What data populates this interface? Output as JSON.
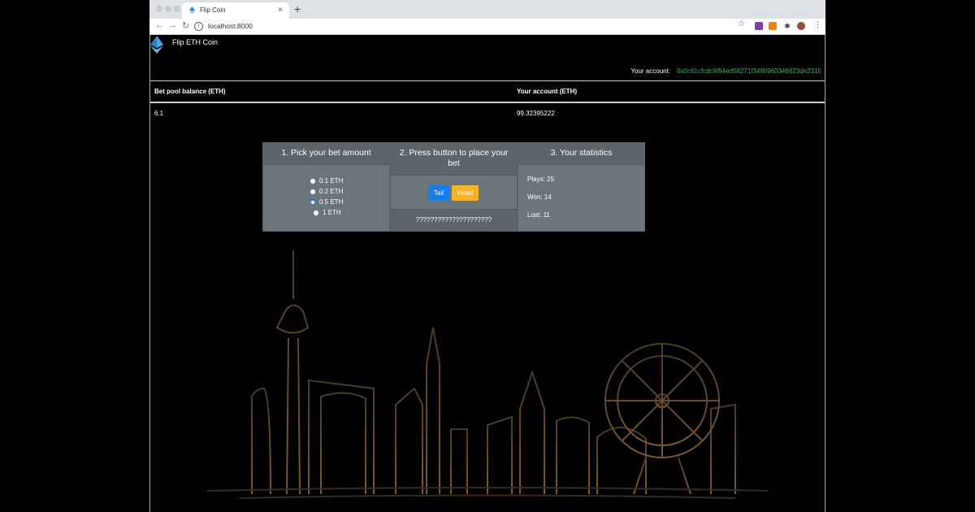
{
  "browser": {
    "tab_title": "Flip Coin",
    "url": "localhost:8000"
  },
  "header": {
    "brand": "Flip ETH Coin",
    "account_label": "Your account:",
    "account_address": "0x0c61cfcdc9f84ed58271f3490960346623de2315"
  },
  "table": {
    "columns": [
      "Bet pool balance (ETH)",
      "Your account (ETH)"
    ],
    "values": [
      "6.1",
      "99.32395222"
    ]
  },
  "cards": {
    "pick": {
      "title": "1. Pick your bet amount",
      "options": [
        "0.1 ETH",
        "0.2 ETH",
        "0.5 ETH",
        "1 ETH"
      ],
      "selected": "0.5 ETH"
    },
    "place": {
      "title": "2. Press button to place your bet",
      "tail_label": "Tail",
      "head_label": "Head",
      "result": "?????????????????????"
    },
    "stats": {
      "title": "3. Your statistics",
      "plays": "Plays: 25",
      "won": "Won: 14",
      "lost": "Lost: 11"
    }
  },
  "colors": {
    "accent_blue": "#1a7de8",
    "accent_yellow": "#f4b42a",
    "address_green": "#3fae6a",
    "card_gray": "#6c747c"
  }
}
